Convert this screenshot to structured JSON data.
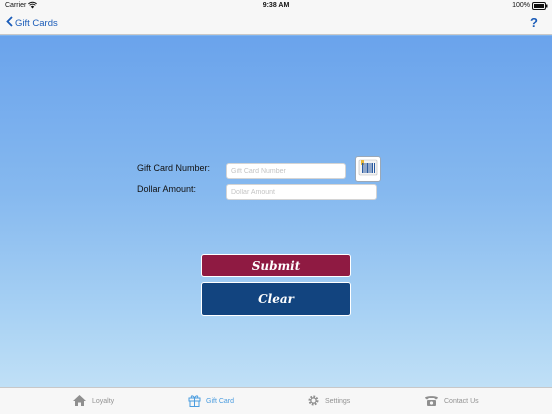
{
  "status_bar": {
    "carrier": "Carrier",
    "time": "9:38 AM",
    "battery": "100%"
  },
  "nav": {
    "back_label": "Gift Cards",
    "help_label": "?"
  },
  "form": {
    "gift_card_label": "Gift Card Number:",
    "gift_card_placeholder": "Gift Card Number",
    "gift_card_value": "",
    "amount_label": "Dollar Amount:",
    "amount_placeholder": "Dollar Amount",
    "amount_value": ""
  },
  "buttons": {
    "submit": "Submit",
    "clear": "Clear"
  },
  "tabs": [
    {
      "label": "Loyalty",
      "icon": "house-icon",
      "active": false
    },
    {
      "label": "Gift Card",
      "icon": "gift-icon",
      "active": true
    },
    {
      "label": "Settings",
      "icon": "gear-icon",
      "active": false
    },
    {
      "label": "Contact Us",
      "icon": "telephone-icon",
      "active": false
    }
  ],
  "colors": {
    "accent": "#1b5cb8",
    "submit": "#8f1a42",
    "clear": "#12447f",
    "active_tab": "#4a9cdf"
  }
}
